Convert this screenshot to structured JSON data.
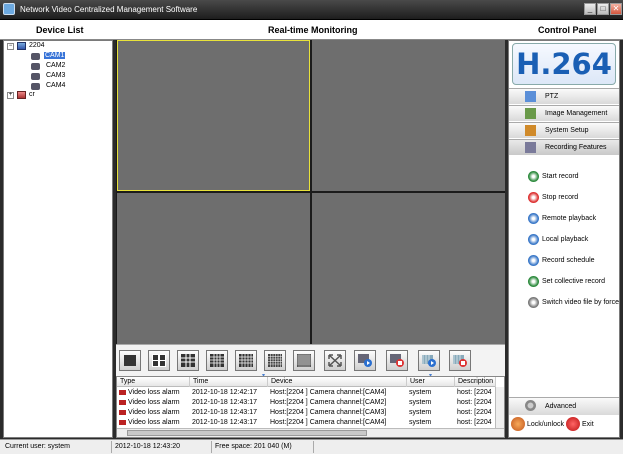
{
  "window": {
    "title": "Network Video Centralized Management Software",
    "minimize": "_",
    "maximize": "□",
    "close": "✕"
  },
  "header": {
    "device_list": "Device List",
    "monitoring": "Real-time Monitoring",
    "control_panel": "Control Panel"
  },
  "device_tree": {
    "host": "2204",
    "cameras": [
      "CAM1",
      "CAM2",
      "CAM3",
      "CAM4"
    ],
    "selected_camera": "CAM1",
    "group": "cr",
    "expanded_symbol": "−",
    "collapsed_symbol": "+"
  },
  "logo": "H.264",
  "panel_tabs": [
    {
      "label": "PTZ",
      "icon": "ptz-icon"
    },
    {
      "label": "Image Management",
      "icon": "image-management-icon"
    },
    {
      "label": "System Setup",
      "icon": "system-setup-icon"
    },
    {
      "label": "Recording Features",
      "icon": "recording-icon"
    }
  ],
  "recording_actions": [
    {
      "label": "Start record",
      "color": "#2e8b3e"
    },
    {
      "label": "Stop record",
      "color": "#d33"
    },
    {
      "label": "Remote playback",
      "color": "#3a78c8"
    },
    {
      "label": "Local playback",
      "color": "#3a78c8"
    },
    {
      "label": "Record schedule",
      "color": "#3a78c8"
    },
    {
      "label": "Set collective record",
      "color": "#2e8b3e"
    },
    {
      "label": "Switch video file by force",
      "color": "#7a7a7a"
    }
  ],
  "advanced_label": "Advanced",
  "lock_label": "Lock/unlock",
  "exit_label": "Exit",
  "event_log": {
    "columns": [
      "Type",
      "Time",
      "Device",
      "User",
      "Description"
    ],
    "rows": [
      [
        "Video loss alarm",
        "2012-10-18 12:42:17",
        "Host:[2204 ] Camera channel:[CAM4]",
        "system",
        "host: [2204"
      ],
      [
        "Video loss alarm",
        "2012-10-18 12:43:17",
        "Host:[2204 ] Camera channel:[CAM2]",
        "system",
        "host: [2204"
      ],
      [
        "Video loss alarm",
        "2012-10-18 12:43:17",
        "Host:[2204 ] Camera channel:[CAM3]",
        "system",
        "host: [2204"
      ],
      [
        "Video loss alarm",
        "2012-10-18 12:43:17",
        "Host:[2204 ] Camera channel:[CAM4]",
        "system",
        "host: [2204"
      ]
    ]
  },
  "status_bar": {
    "user": "Current user: system",
    "time": "2012-10-18 12:43:20",
    "free_space": "Free space: 201 040 (M)"
  },
  "colors": {
    "accent": "#1a5fb4",
    "active_pane": "#e8e23a",
    "selection": "#3874d8"
  }
}
